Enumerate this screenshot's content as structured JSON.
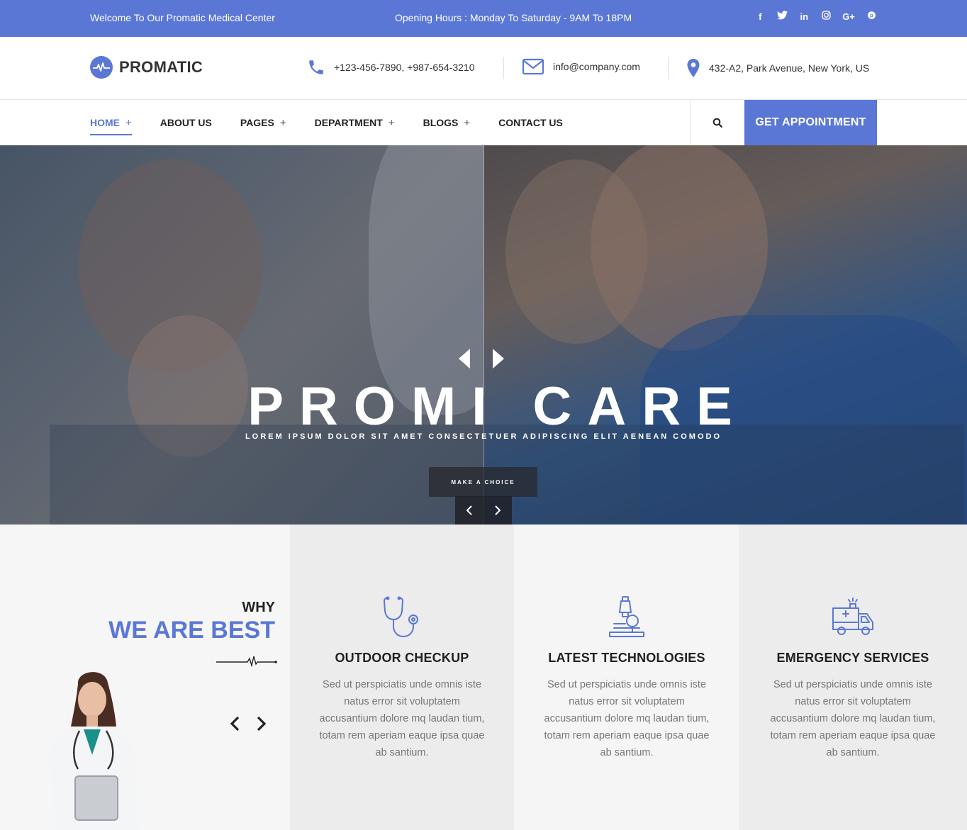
{
  "topbar": {
    "welcome": "Welcome To Our Promatic Medical Center",
    "hours": "Opening Hours : Monday To Saturday - 9AM To 18PM",
    "social": [
      {
        "icon": "facebook-icon",
        "glyph": "f"
      },
      {
        "icon": "twitter-icon",
        "glyph": "t"
      },
      {
        "icon": "linkedin-icon",
        "glyph": "in"
      },
      {
        "icon": "instagram-icon",
        "glyph": "◎"
      },
      {
        "icon": "google-plus-icon",
        "glyph": "G+"
      },
      {
        "icon": "pinterest-icon",
        "glyph": "℗"
      }
    ]
  },
  "header": {
    "logo": "PROMATIC",
    "phone": "+123-456-7890, +987-654-3210",
    "email": "info@company.com",
    "address": "432-A2, Park Avenue, New York, US"
  },
  "nav": {
    "items": [
      {
        "label": "HOME",
        "plus": "+"
      },
      {
        "label": "ABOUT US",
        "plus": ""
      },
      {
        "label": "PAGES",
        "plus": "+"
      },
      {
        "label": "DEPARTMENT",
        "plus": "+"
      },
      {
        "label": "BLOGS",
        "plus": "+"
      },
      {
        "label": "CONTACT US",
        "plus": ""
      }
    ],
    "cta": "GET APPOINTMENT"
  },
  "hero": {
    "title": "PROMI CARE",
    "subtitle": "LOREM IPSUM DOLOR SIT AMET CONSECTETUER ADIPISCING ELIT AENEAN COMODO",
    "button": "MAKE A CHOICE"
  },
  "why": {
    "small": "WHY",
    "big": "WE ARE BEST"
  },
  "features": [
    {
      "icon": "stethoscope-icon",
      "title": "OUTDOOR CHECKUP",
      "text": "Sed ut perspiciatis unde omnis iste natus error sit voluptatem accusantium dolore mq laudan tium, totam rem aperiam eaque ipsa quae ab santium."
    },
    {
      "icon": "microscope-icon",
      "title": "LATEST TECHNOLOGIES",
      "text": "Sed ut perspiciatis unde omnis iste natus error sit voluptatem accusantium dolore mq laudan tium, totam rem aperiam eaque ipsa quae ab santium."
    },
    {
      "icon": "ambulance-icon",
      "title": "EMERGENCY SERVICES",
      "text": "Sed ut perspiciatis unde omnis iste natus error sit voluptatem accusantium dolore mq laudan tium, totam rem aperiam eaque ipsa quae ab santium."
    }
  ],
  "colors": {
    "accent": "#5b77d6",
    "text": "#222222",
    "muted": "#777777"
  }
}
